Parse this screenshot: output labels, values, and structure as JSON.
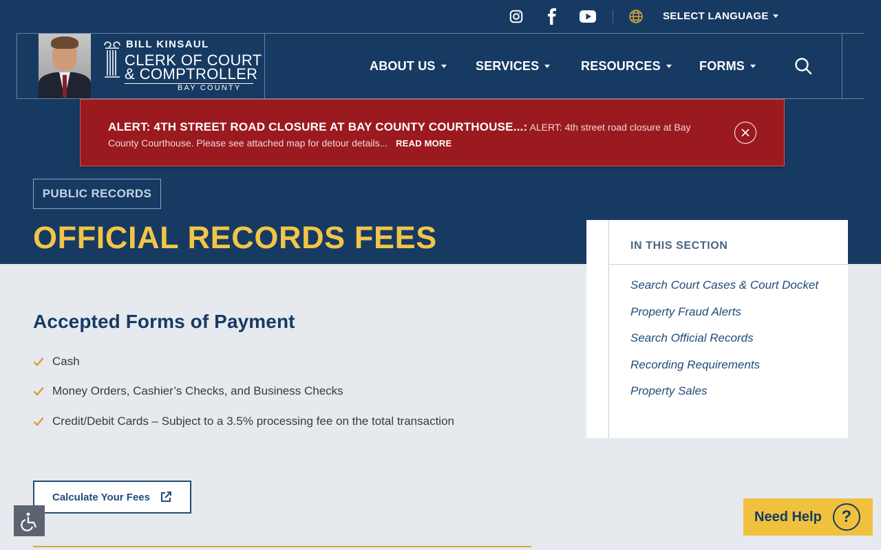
{
  "header": {
    "social": [
      {
        "name": "instagram-icon"
      },
      {
        "name": "facebook-icon"
      },
      {
        "name": "youtube-icon"
      }
    ],
    "language_label": "SELECT LANGUAGE",
    "logo": {
      "name": "BILL KINSAUL",
      "line1": "CLERK OF COURT",
      "line2": "& COMPTROLLER",
      "county": "BAY COUNTY"
    },
    "nav": [
      "ABOUT US",
      "SERVICES",
      "RESOURCES",
      "FORMS"
    ]
  },
  "alert": {
    "title": "ALERT: 4TH STREET ROAD CLOSURE AT BAY COUNTY COURTHOUSE...:",
    "body": "ALERT: 4th street road closure at Bay County Courthouse. Please see attached map for detour details...",
    "read_more": "READ MORE"
  },
  "page": {
    "section_tag": "PUBLIC RECORDS",
    "title": "OFFICIAL RECORDS FEES"
  },
  "sidebar": {
    "heading": "IN THIS SECTION",
    "links": [
      "Search Court Cases & Court Docket",
      "Property Fraud Alerts",
      "Search Official Records",
      "Recording Requirements",
      "Property Sales"
    ]
  },
  "content": {
    "heading": "Accepted Forms of Payment",
    "payments": [
      "Cash",
      "Money Orders, Cashier’s Checks, and Business Checks",
      "Credit/Debit Cards – Subject to a 3.5% processing fee on the total transaction"
    ],
    "calc_button": "Calculate Your Fees"
  },
  "widgets": {
    "help_label": "Need Help",
    "help_glyph": "?"
  },
  "colors": {
    "navy": "#173a63",
    "gold": "#f2c548",
    "alert_red": "#9b1a1f",
    "link_blue": "#1f4b7a"
  }
}
